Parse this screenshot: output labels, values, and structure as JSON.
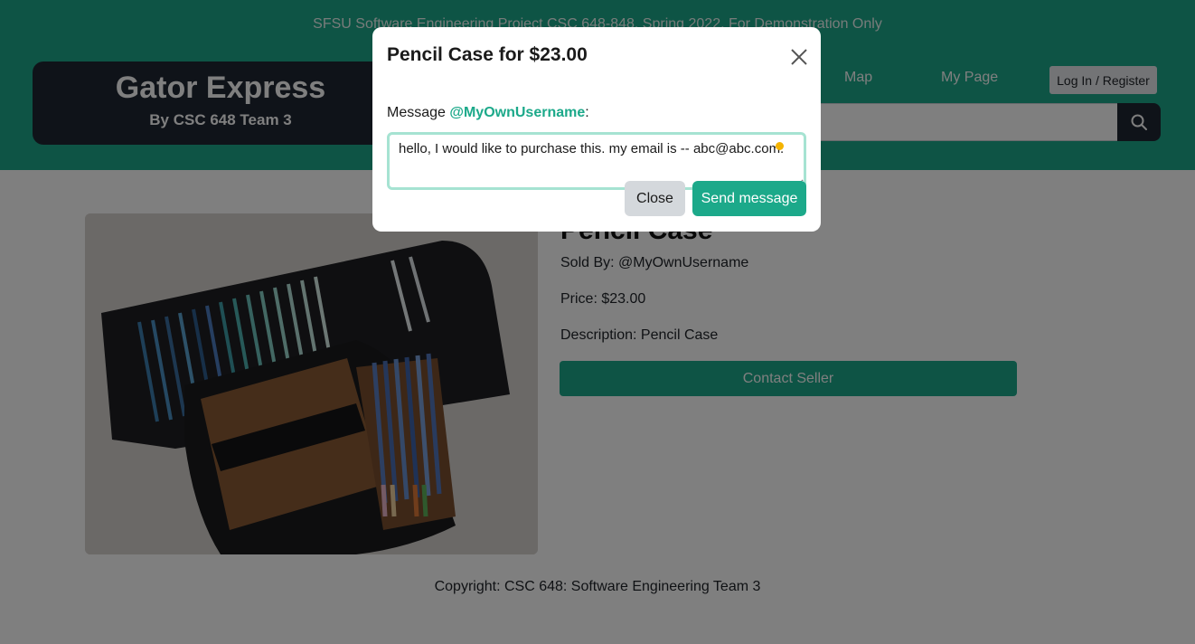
{
  "header": {
    "banner": "SFSU Software Engineering Project CSC 648-848, Spring 2022. For Demonstration Only",
    "brand_title": "Gator Express",
    "brand_subtitle": "By CSC 648 Team 3",
    "nav": {
      "map": "Map",
      "my_page": "My Page"
    },
    "login_label": "Log In / Register",
    "search_value": "",
    "search_icon": "search-icon"
  },
  "product": {
    "title": "Pencil Case",
    "sold_by": "Sold By: @MyOwnUsername",
    "price": "Price: $23.00",
    "description": "Description: Pencil Case",
    "contact_label": "Contact Seller",
    "image_alt": "photo of pencil case"
  },
  "footer": {
    "copyright": "Copyright: CSC 648: Software Engineering Team 3"
  },
  "modal": {
    "title": "Pencil Case for $23.00",
    "message_prefix": "Message ",
    "username": "@MyOwnUsername",
    "message_suffix": ":",
    "message_value": "hello, I would like to purchase this. my email is -- abc@abc.com.",
    "close_label": "Close",
    "send_label": "Send message",
    "close_icon": "close-icon"
  },
  "colors": {
    "accent": "#1ca98a",
    "dark": "#1f2733",
    "focus_ring": "#a6e3d2"
  }
}
